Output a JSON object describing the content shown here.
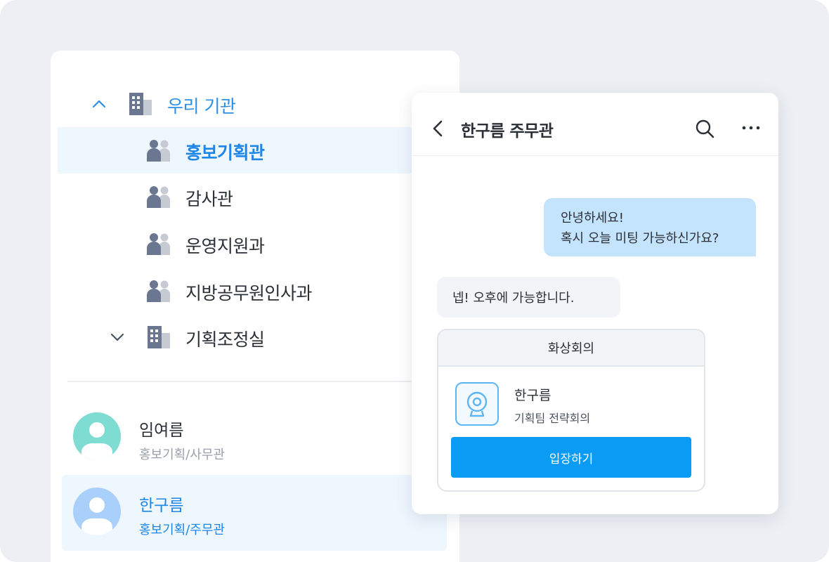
{
  "org_tree": {
    "root": {
      "label": "우리 기관",
      "expanded": true,
      "icon": "building-icon"
    },
    "items": [
      {
        "label": "홍보기획관",
        "selected": true,
        "icon": "group-icon"
      },
      {
        "label": "감사관",
        "selected": false,
        "icon": "group-icon"
      },
      {
        "label": "운영지원과",
        "selected": false,
        "icon": "group-icon"
      },
      {
        "label": "지방공무원인사과",
        "selected": false,
        "icon": "group-icon"
      }
    ],
    "collapsed_node": {
      "label": "기획조정실",
      "expanded": false,
      "icon": "building-icon"
    }
  },
  "people": [
    {
      "name": "임여름",
      "dept": "홍보기획/사무관",
      "avatar_color": "#7fdcd3",
      "selected": false
    },
    {
      "name": "한구름",
      "dept": "홍보기획/주무관",
      "avatar_color": "#a9d0fb",
      "selected": true
    }
  ],
  "chat": {
    "title": "한구름 주무관",
    "messages": {
      "outgoing": {
        "line1": "안녕하세요!",
        "line2": "혹시 오늘 미팅 가능하신가요?"
      },
      "incoming": "넵! 오후에 가능합니다."
    },
    "meeting_card": {
      "header": "화상회의",
      "host": "한구름",
      "subject": "기획팀 전략회의",
      "join_label": "입장하기"
    }
  },
  "colors": {
    "accent": "#1d86e6",
    "button": "#0a9cf5",
    "outgoing_bubble": "#c4e3fd",
    "incoming_bubble": "#f3f4f8",
    "selected_row": "#eef6fe"
  }
}
